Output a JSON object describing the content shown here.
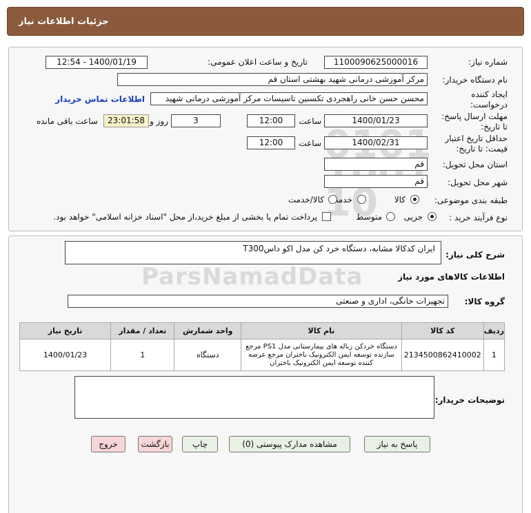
{
  "header": {
    "title": "جزئیات اطلاعات نیاز"
  },
  "form": {
    "need_number_label": "شماره نیاز:",
    "need_number": "1100090625000016",
    "announce_label": "تاریخ و ساعت اعلان عمومی:",
    "announce_value": "1400/01/19 - 12:54",
    "buyer_label": "نام دستگاه خریدار:",
    "buyer_value": "مرکز آموزشی درمانی شهید بهشتی استان قم",
    "creator_label_1": "ایجاد کننده",
    "creator_label_2": "درخواست:",
    "creator_value": "محسن حسن خانی راهجردی تکسنین تاسیسات مرکز آموزشی درمانی شهید",
    "contact_link": "اطلاعات تماس خریدار",
    "deadline_label_1": "مهلت ارسال پاسخ:",
    "deadline_label_2": "تا تاریخ:",
    "deadline_date": "1400/01/23",
    "time_label": "ساعت",
    "deadline_time": "12:00",
    "days_value": "3",
    "days_label": "روز و",
    "remaining_time": "23:01:58",
    "remaining_label": "ساعت باقی مانده",
    "validity_label_1": "حداقل تاریخ اعتبار",
    "validity_label_2": "قیمت: تا تاریخ:",
    "validity_date": "1400/02/31",
    "validity_time": "12:00",
    "province_label": "استان محل تحویل:",
    "province_value": "قم",
    "city_label": "شهر محل تحویل:",
    "city_value": "قم",
    "category_label": "طبقه بندی موضوعی:",
    "category_options": [
      "کالا",
      "خدمت",
      "کالا/خدمت"
    ],
    "category_selected": "کالا",
    "process_label": "نوع فرآیند خرید :",
    "process_options": [
      "جزیی",
      "متوسط"
    ],
    "process_selected": "جزیی",
    "payment_note": "پرداخت تمام یا بخشی از مبلغ خرید،از محل \"اسناد خزانه اسلامی\" خواهد بود."
  },
  "summary": {
    "label": "شرح کلی نیاز:",
    "value": "ایران کدکالا مشابه، دستگاه خرد کن مدل اکو داسT300"
  },
  "goods": {
    "section_title": "اطلاعات کالاهای مورد نیاز",
    "group_label": "گروه کالا:",
    "group_value": "تجهیزات خانگی، اداری و صنعتی",
    "columns": [
      "ردیف",
      "کد کالا",
      "نام کالا",
      "واحد شمارش",
      "تعداد / مقدار",
      "تاریخ نیاز"
    ],
    "rows": [
      {
        "row": "1",
        "code": "2134500862410002",
        "name": "دستگاه خردکن زباله های بیمارستانی مدل PS1 مرجع سازنده توسعه ایمن الکترونیک باختران مرجع عرضه کننده توسعه ایمن الکترونیک باختران",
        "unit": "دستگاه",
        "qty": "1",
        "date": "1400/01/23"
      }
    ]
  },
  "buyer_notes": {
    "label": "توضیحات خریدار:",
    "value": ""
  },
  "buttons": {
    "reply": "پاسخ به نیاز",
    "attachments": "مشاهده مدارک پیوستی (0)",
    "print": "چاپ",
    "back": "بازگشت",
    "exit": "خروج"
  },
  "colors": {
    "header": "#8b5a3c",
    "panel": "#f7f7f7",
    "link": "#1a3fc0",
    "remaining_bg": "#f6f1c7"
  }
}
